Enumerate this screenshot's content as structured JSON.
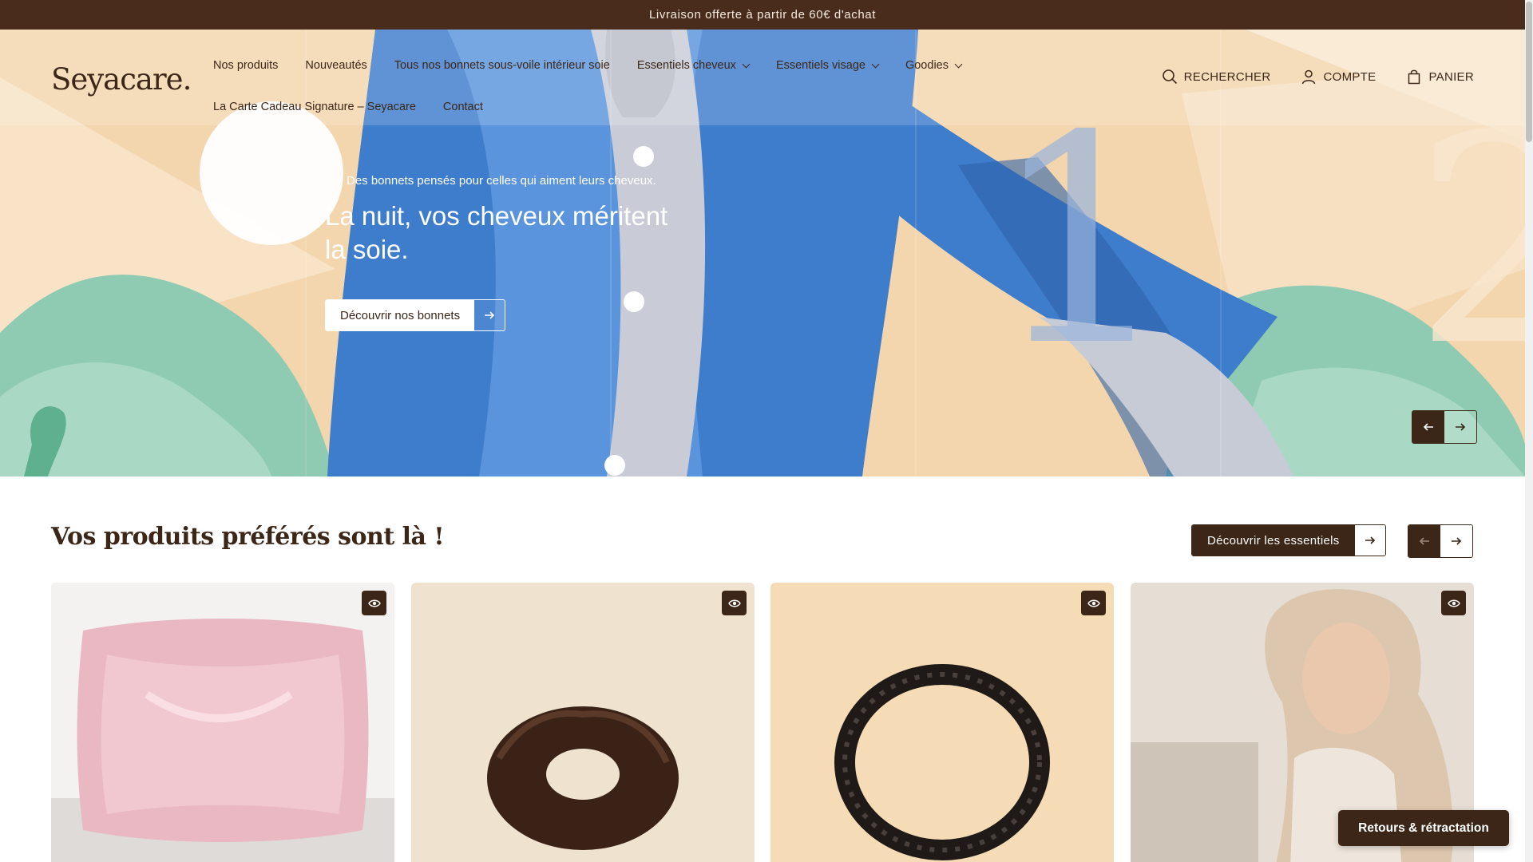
{
  "announcement": {
    "text": "Livraison offerte à partir de 60€ d'achat"
  },
  "brand": {
    "logo_text": "Seyacare."
  },
  "nav": {
    "items": [
      {
        "label": "Nos produits",
        "has_dropdown": false
      },
      {
        "label": "Nouveautés",
        "has_dropdown": false
      },
      {
        "label": "Tous nos bonnets sous-voile intérieur soie",
        "has_dropdown": false
      },
      {
        "label": "Essentiels cheveux",
        "has_dropdown": true
      },
      {
        "label": "Essentiels visage",
        "has_dropdown": true
      },
      {
        "label": "Goodies",
        "has_dropdown": true
      },
      {
        "label": "La Carte Cadeau Signature – Seyacare",
        "has_dropdown": false
      },
      {
        "label": "Contact",
        "has_dropdown": false
      }
    ]
  },
  "header_actions": {
    "search_label": "RECHERCHER",
    "account_label": "COMPTE",
    "cart_label": "PANIER"
  },
  "hero": {
    "eyebrow": "Des bonnets pensés pour celles qui aiment leurs cheveux.",
    "title": "La nuit, vos cheveux méritent la soie.",
    "cta_label": "Découvrir nos bonnets",
    "illustration_number": "1"
  },
  "products_section": {
    "title": "Vos produits préférés sont là !",
    "cta_label": "Découvrir les essentiels",
    "products": [
      {
        "name": "pink-silk-pillowcase"
      },
      {
        "name": "brown-silk-scrunchie"
      },
      {
        "name": "black-silk-headband"
      },
      {
        "name": "beige-silk-bonnet"
      }
    ]
  },
  "returns_button": {
    "label": "Retours & rétractation"
  },
  "colors": {
    "brand_brown": "#3b2618",
    "announcement_bg": "#4a2c1c",
    "hero_sand": "#f3d6ae",
    "hero_blue": "#3e7ccc",
    "hero_mint": "#8fcab3"
  },
  "icons": [
    "search-icon",
    "user-icon",
    "bag-icon",
    "arrow-left-icon",
    "arrow-right-icon",
    "eye-icon",
    "chevron-down-icon"
  ]
}
